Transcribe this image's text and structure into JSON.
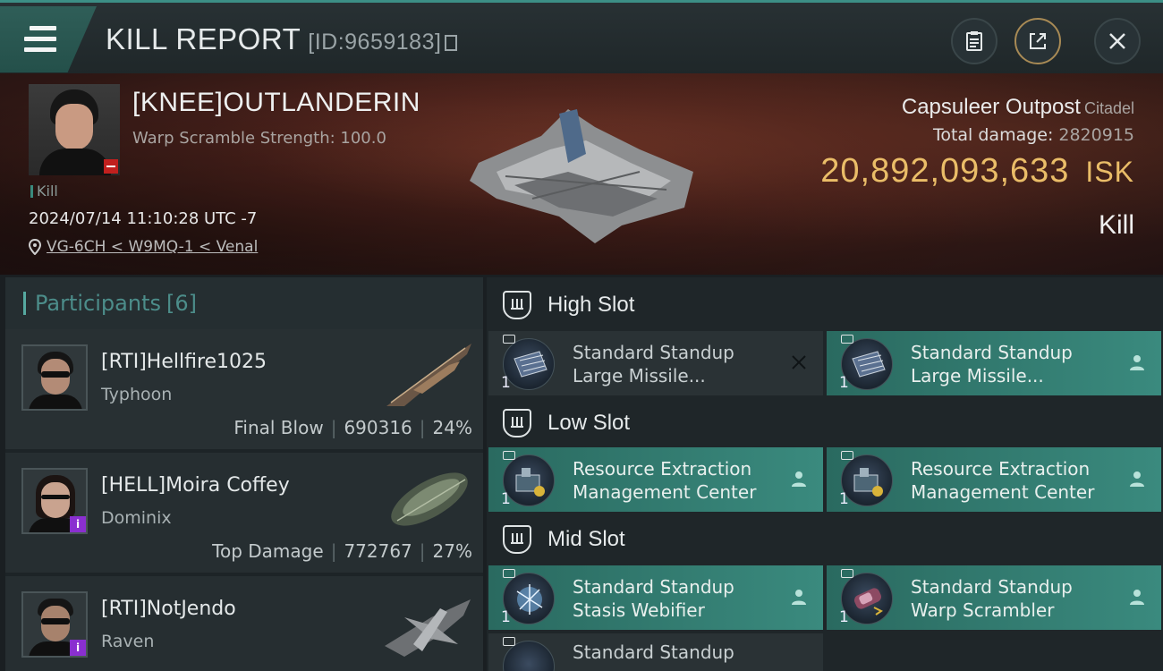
{
  "header": {
    "title": "KILL REPORT",
    "report_id": "[ID:9659183]",
    "buttons": [
      "clipboard-icon",
      "export-icon",
      "close-icon"
    ]
  },
  "victim": {
    "name": "[KNEE]OUTLANDERIN",
    "subtitle": "Warp Scramble Strength: 100.0",
    "tag": "Kill",
    "datetime": "2024/07/14 11:10:28 UTC -7",
    "location": "VG-6CH < W9MQ-1 < Venal",
    "structure": "Capsuleer Outpost",
    "structure_class": "Citadel",
    "total_damage_label": "Total damage:",
    "total_damage": "2820915",
    "isk_value": "20,892,093,633",
    "isk_unit": "ISK",
    "report_type": "Kill"
  },
  "participants": {
    "label": "Participants",
    "count": "[6]",
    "rows": [
      {
        "name": "[RTI]Hellfire1025",
        "ship": "Typhoon",
        "role": "Final Blow",
        "damage": "690316",
        "pct": "24%"
      },
      {
        "name": "[HELL]Moira Coffey",
        "ship": "Dominix",
        "role": "Top Damage",
        "damage": "772767",
        "pct": "27%"
      },
      {
        "name": "[RTI]NotJendo",
        "ship": "Raven",
        "role": "",
        "damage": "",
        "pct": ""
      }
    ]
  },
  "fitting": {
    "high": {
      "label": "High Slot",
      "modules": [
        {
          "name": "Standard Standup Large Missile...",
          "qty": "1",
          "status": "destroyed"
        },
        {
          "name": "Standard Standup Large Missile...",
          "qty": "1",
          "status": "dropped"
        }
      ]
    },
    "low": {
      "label": "Low Slot",
      "modules": [
        {
          "name": "Resource Extraction Management Center",
          "qty": "1",
          "status": "dropped"
        },
        {
          "name": "Resource Extraction Management Center",
          "qty": "1",
          "status": "dropped"
        }
      ]
    },
    "mid": {
      "label": "Mid Slot",
      "modules": [
        {
          "name": "Standard Standup Stasis Webifier",
          "qty": "1",
          "status": "dropped"
        },
        {
          "name": "Standard Standup Warp Scrambler",
          "qty": "1",
          "status": "dropped"
        },
        {
          "name": "Standard Standup",
          "qty": "",
          "status": "destroyed"
        }
      ]
    }
  },
  "colors": {
    "accent": "#3a8a7e",
    "isk": "#eabd68",
    "danger": "#c1201e"
  }
}
